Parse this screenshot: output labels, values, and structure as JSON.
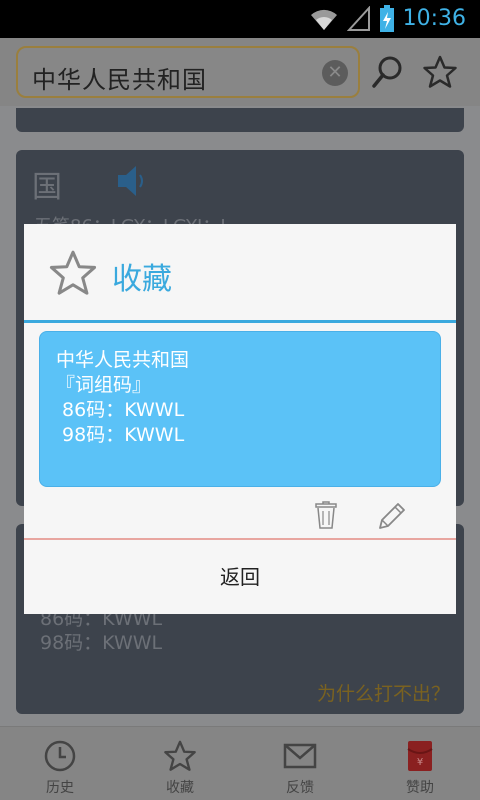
{
  "status": {
    "time": "10:36"
  },
  "search": {
    "value": "中华人民共和国",
    "clear_icon": "clear-icon"
  },
  "result": {
    "char": "国",
    "wubi_line": "五笔86：LGY；LGYI；L",
    "codes": [
      "86码：KWWL",
      "98码：KWWL"
    ],
    "why_link": "为什么打不出？"
  },
  "nav": [
    {
      "label": "历史",
      "icon": "clock-icon"
    },
    {
      "label": "收藏",
      "icon": "star-icon"
    },
    {
      "label": "反馈",
      "icon": "mail-icon"
    },
    {
      "label": "赞助",
      "icon": "red-envelope-icon"
    }
  ],
  "dialog": {
    "title": "收藏",
    "favorite": {
      "lines": [
        "中华人民共和国",
        "『词组码』",
        " 86码：KWWL",
        " 98码：KWWL"
      ]
    },
    "back_label": "返回"
  },
  "colors": {
    "accent": "#3aa9de",
    "card": "#5bc2f7"
  }
}
